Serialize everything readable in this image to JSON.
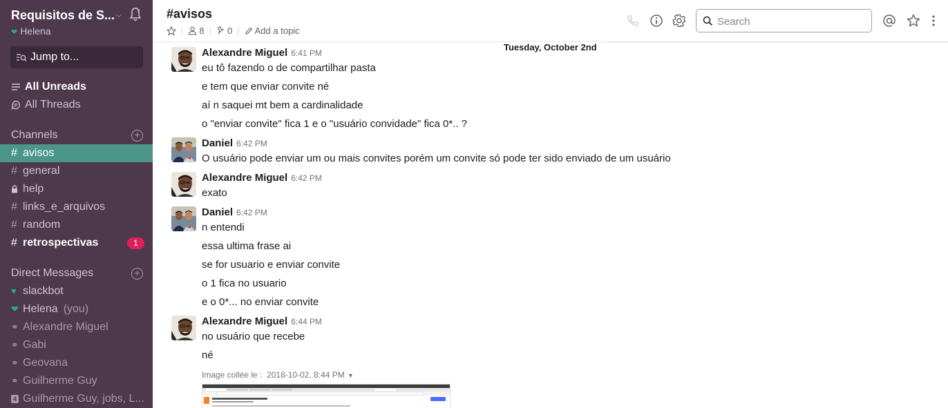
{
  "team": {
    "name": "Requisitos de S...",
    "user": "Helena"
  },
  "sidebar": {
    "jump_to": "Jump to...",
    "nav": [
      {
        "label": "All Unreads",
        "icon": "all-unreads-icon"
      },
      {
        "label": "All Threads",
        "icon": "threads-icon"
      }
    ],
    "channels_title": "Channels",
    "channels": [
      {
        "name": "avisos",
        "prefix": "#",
        "active": true
      },
      {
        "name": "general",
        "prefix": "#"
      },
      {
        "name": "help",
        "prefix": "lock"
      },
      {
        "name": "links_e_arquivos",
        "prefix": "#"
      },
      {
        "name": "random",
        "prefix": "#"
      },
      {
        "name": "retrospectivas",
        "prefix": "#",
        "unread": true,
        "badge": "1"
      }
    ],
    "dm_title": "Direct Messages",
    "dms": [
      {
        "name": "slackbot",
        "presence": "heart"
      },
      {
        "name": "Helena",
        "suffix": "(you)",
        "presence": "active"
      },
      {
        "name": "Alexandre Miguel",
        "presence": "away"
      },
      {
        "name": "Gabi",
        "presence": "away"
      },
      {
        "name": "Geovana",
        "presence": "away"
      },
      {
        "name": "Guilherme Guy",
        "presence": "away"
      },
      {
        "name": "Guilherme Guy, jobs, L...",
        "presence": "group",
        "count": "4"
      }
    ]
  },
  "header": {
    "title": "#avisos",
    "members": "8",
    "pins": "0",
    "add_topic": "Add a topic",
    "search_placeholder": "Search"
  },
  "day_divider": "Tuesday, October 2nd",
  "messages": [
    {
      "author": "Alexandre Miguel",
      "time": "6:41 PM",
      "avatar": "alexandre",
      "lines": [
        "eu tô fazendo o de compartilhar pasta",
        "e tem que enviar convite né",
        "aí n saquei mt bem a cardinalidade",
        "o \"enviar convite\" fica 1 e o \"usuário convidade\" fica 0*.. ?"
      ]
    },
    {
      "author": "Daniel",
      "time": "6:42 PM",
      "avatar": "daniel",
      "lines": [
        "O usuário pode enviar um ou mais convites porém um convite só pode ter sido enviado de um usuário"
      ]
    },
    {
      "author": "Alexandre Miguel",
      "time": "6:42 PM",
      "avatar": "alexandre",
      "lines": [
        "exato"
      ]
    },
    {
      "author": "Daniel",
      "time": "6:42 PM",
      "avatar": "daniel",
      "lines": [
        "n entendi",
        "essa ultima frase ai",
        "se for usuario e enviar convite",
        "o 1 fica no usuario",
        "e o 0*... no enviar convite"
      ]
    },
    {
      "author": "Alexandre Miguel",
      "time": "6:44 PM",
      "avatar": "alexandre",
      "lines": [
        "no usuário que recebe",
        "né"
      ]
    }
  ],
  "image_meta": {
    "label": "Image collée le :",
    "date": "2018-10-02, 8:44 PM"
  },
  "colors": {
    "sidebar_bg": "#4d394b",
    "active_channel": "#4c9689",
    "badge": "#e01e5a",
    "presence": "#2bac76"
  }
}
